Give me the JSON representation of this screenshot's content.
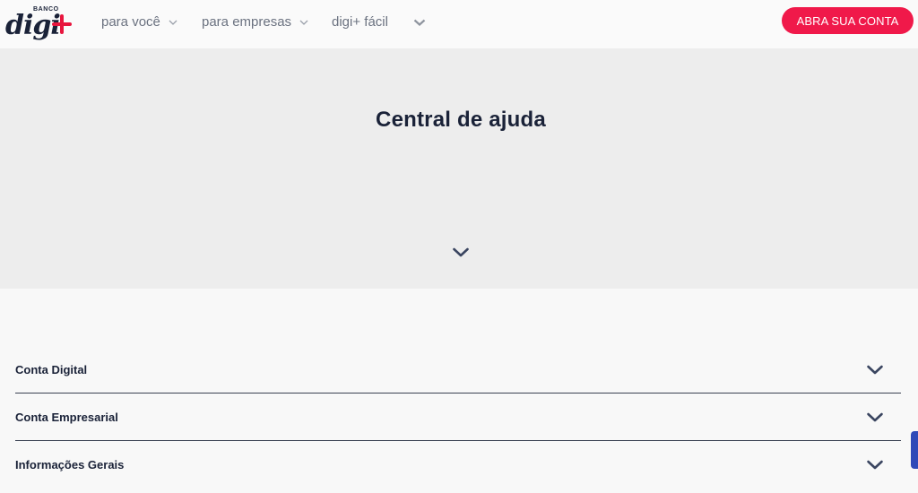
{
  "header": {
    "logo": {
      "top_text": "BANCO",
      "word": "digi",
      "plus": "+"
    },
    "nav": [
      {
        "label": "para você"
      },
      {
        "label": "para empresas"
      },
      {
        "label": "digi+ fácil"
      }
    ],
    "cta_label": "ABRA SUA CONTA"
  },
  "hero": {
    "title": "Central de ajuda",
    "expand_icon": "chevron-down-icon"
  },
  "faq": {
    "items": [
      {
        "label": "Conta Digital"
      },
      {
        "label": "Conta Empresarial"
      },
      {
        "label": "Informações Gerais"
      }
    ]
  },
  "colors": {
    "brand_navy": "#1a2238",
    "brand_red": "#e8163e",
    "cta_bg": "#f0194a",
    "hero_bg": "#ededed",
    "side_tab": "#2f49b8"
  }
}
